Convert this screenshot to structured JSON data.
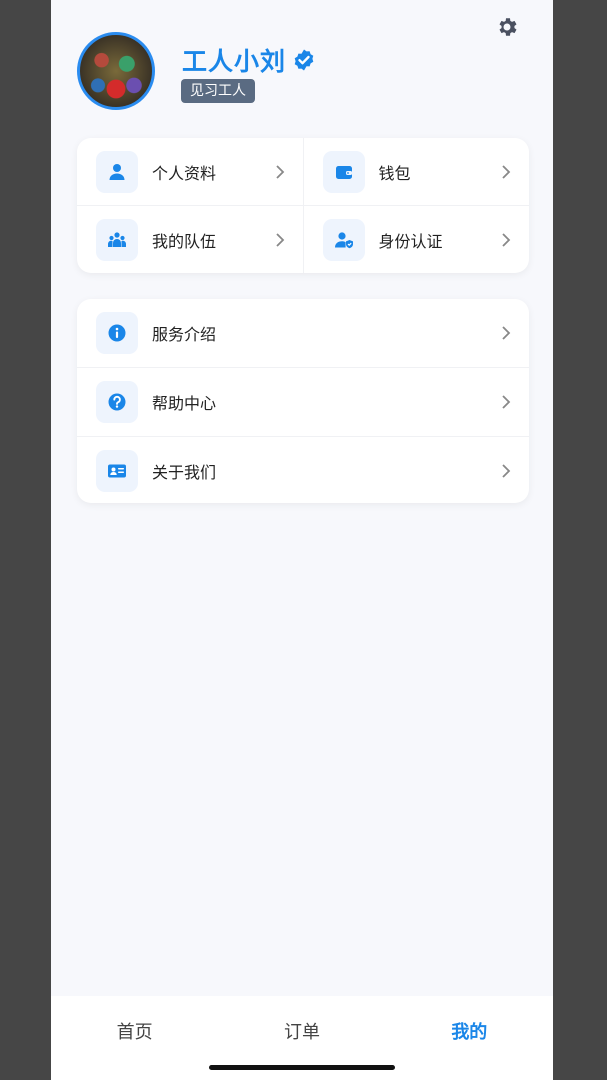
{
  "profile": {
    "name": "工人小刘",
    "badge": "见习工人"
  },
  "colors": {
    "accent": "#1a86e8",
    "badge_bg": "#5a6b82",
    "icon_bg": "#eef4fd"
  },
  "quick_menu": [
    {
      "label": "个人资料",
      "icon": "person-icon"
    },
    {
      "label": "钱包",
      "icon": "wallet-icon"
    },
    {
      "label": "我的队伍",
      "icon": "team-icon"
    },
    {
      "label": "身份认证",
      "icon": "id-verify-icon"
    }
  ],
  "service_menu": [
    {
      "label": "服务介绍",
      "icon": "info-icon"
    },
    {
      "label": "帮助中心",
      "icon": "help-icon"
    },
    {
      "label": "关于我们",
      "icon": "id-card-icon"
    }
  ],
  "tabbar": {
    "home": "首页",
    "orders": "订单",
    "mine": "我的",
    "active": "mine"
  }
}
